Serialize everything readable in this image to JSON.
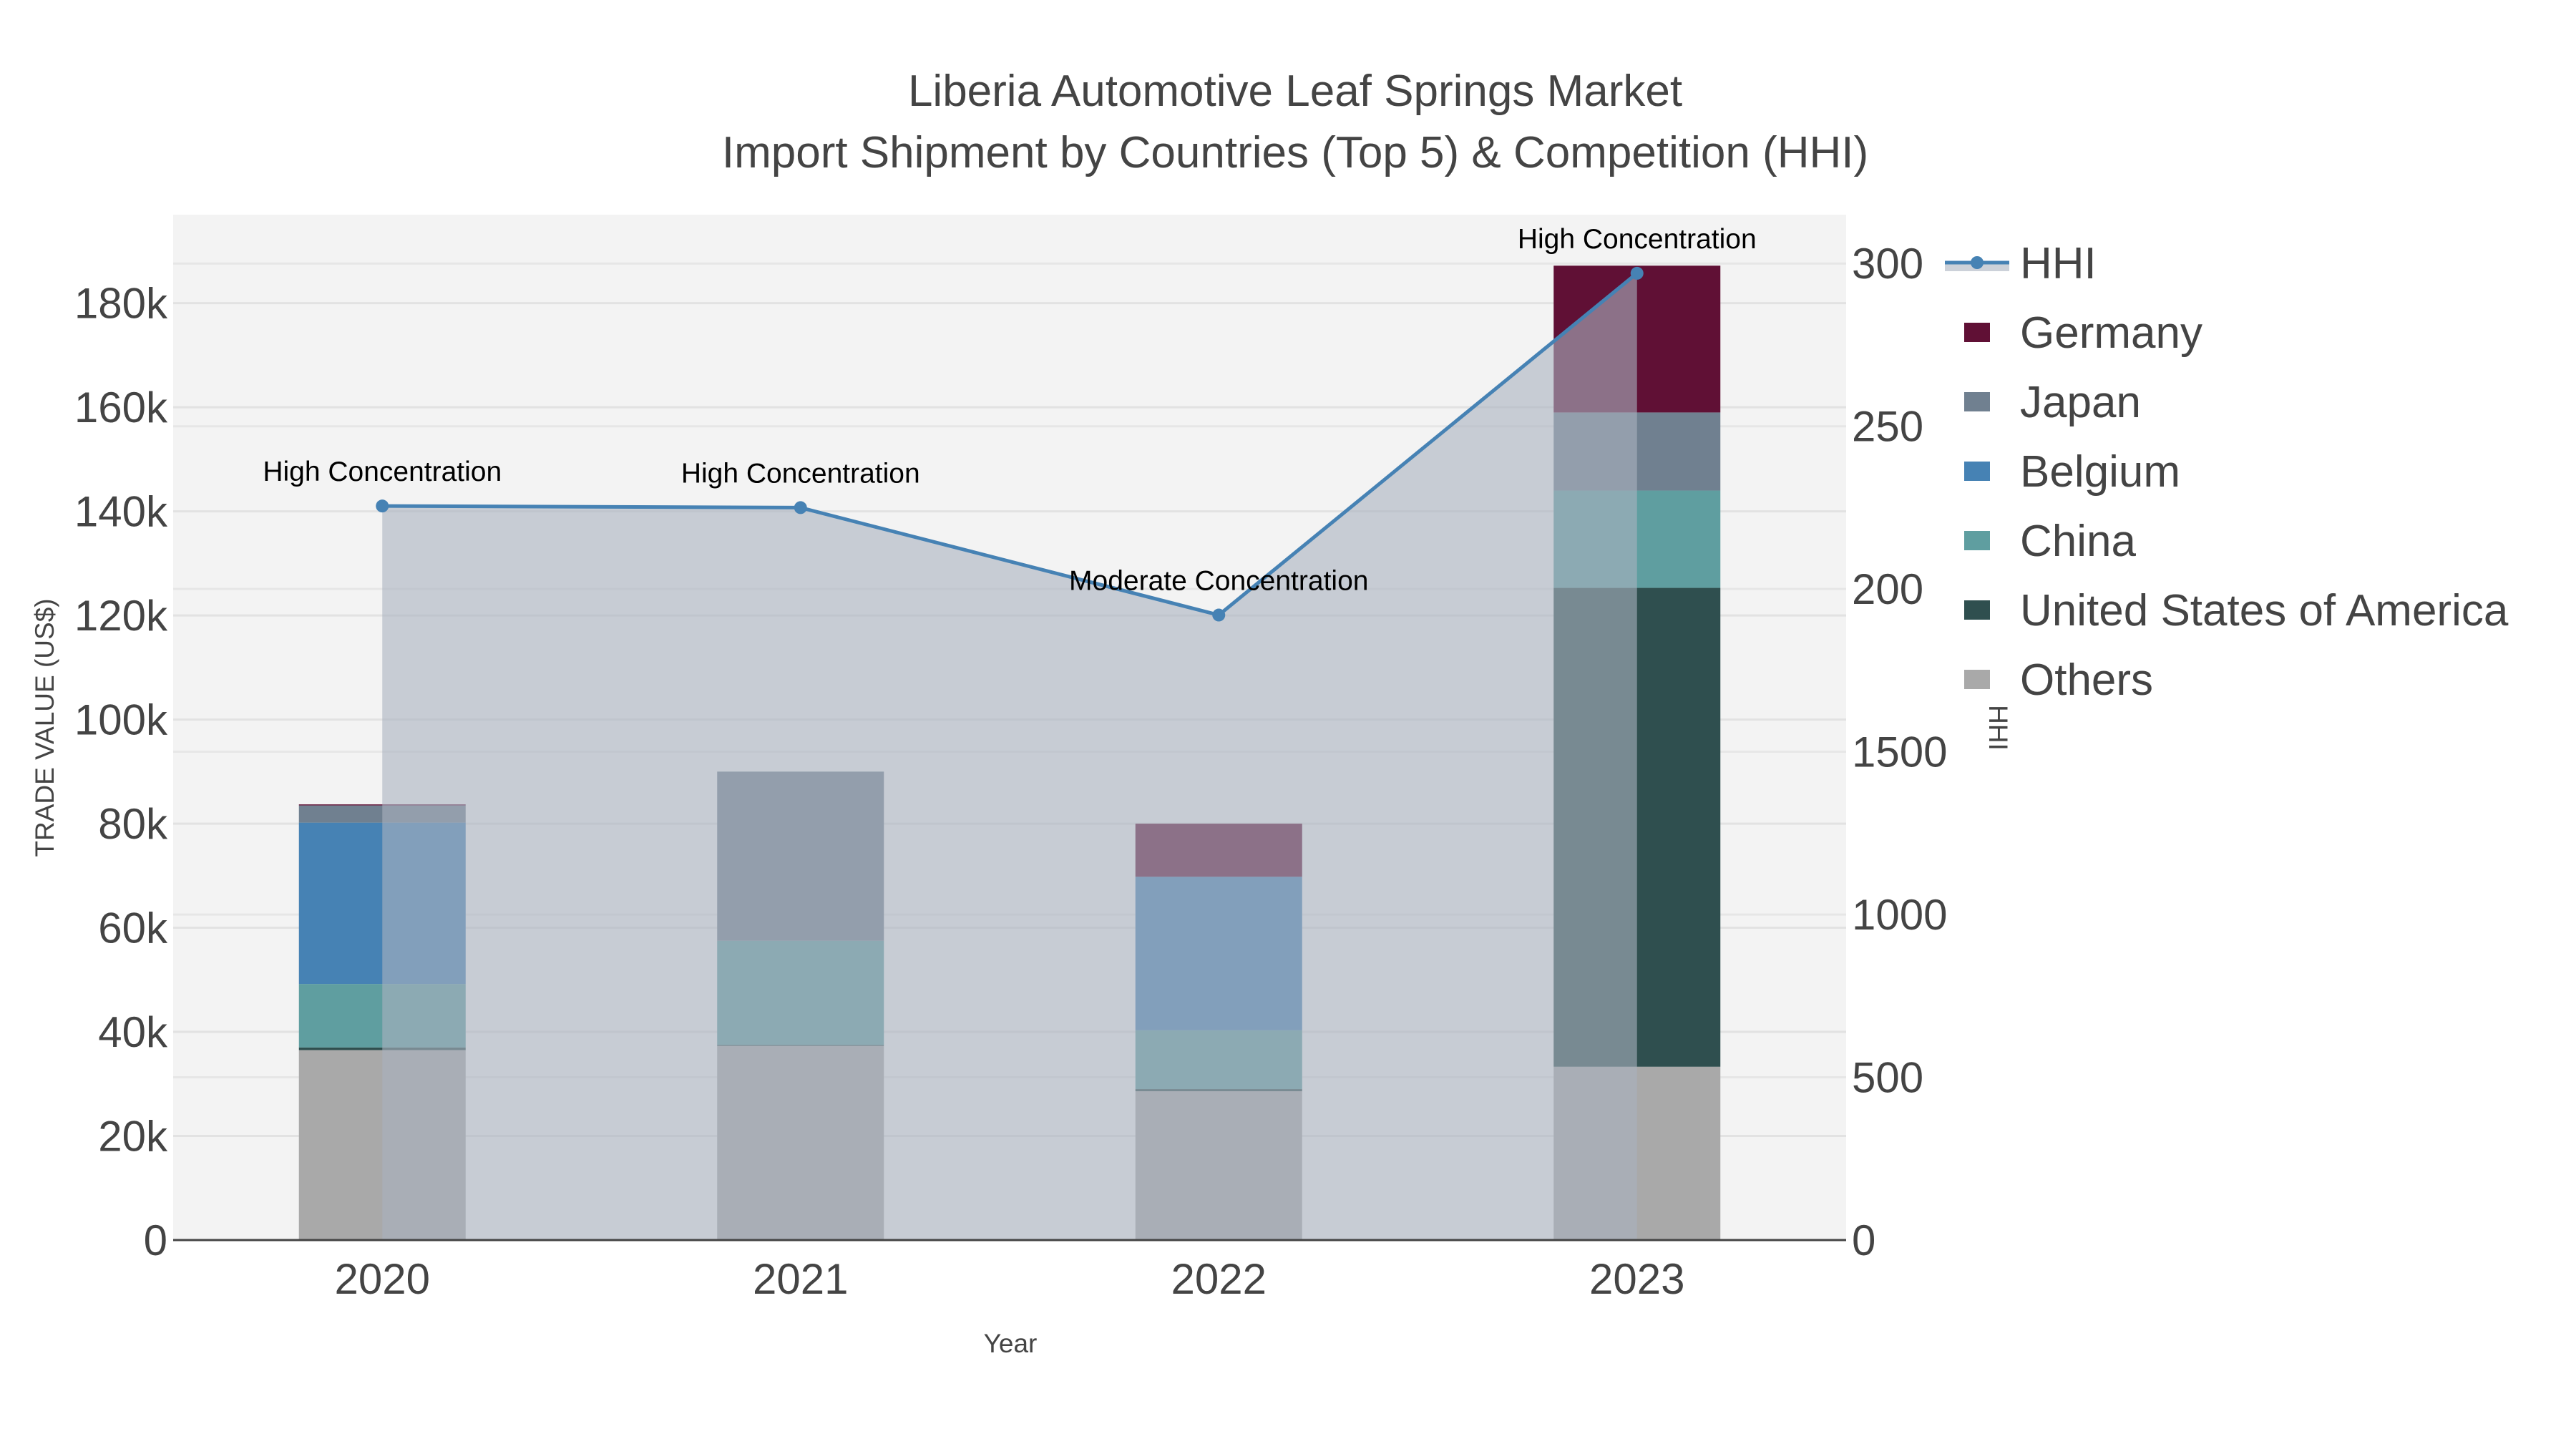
{
  "chart_data": {
    "type": "bar",
    "title": "Liberia Automotive Leaf Springs Market",
    "subtitle": "Import Shipment by Countries (Top 5) & Competition (HHI)",
    "xlabel": "Year",
    "ylabel": "TRADE VALUE (US$)",
    "y2label": "HHI",
    "categories": [
      "2020",
      "2021",
      "2022",
      "2023"
    ],
    "ylim": [
      0,
      197000
    ],
    "yticks": [
      0,
      20000,
      40000,
      60000,
      80000,
      100000,
      120000,
      140000,
      160000,
      180000
    ],
    "ytick_labels": [
      "0",
      "20k",
      "40k",
      "60k",
      "80k",
      "100k",
      "120k",
      "140k",
      "160k",
      "180k"
    ],
    "y2lim": [
      0,
      3150
    ],
    "y2ticks": [
      0,
      500,
      1000,
      1500,
      2000,
      2500,
      3000
    ],
    "y2tick_labels": [
      "0",
      "500",
      "1000",
      "1500",
      "200",
      "250",
      "300"
    ],
    "stacked": true,
    "series": [
      {
        "name": "Others",
        "color": "#a9a9a9",
        "values": [
          36500,
          37300,
          28600,
          33300
        ]
      },
      {
        "name": "United States of America",
        "color": "#2f4f4f",
        "values": [
          500,
          200,
          400,
          92000
        ]
      },
      {
        "name": "China",
        "color": "#5f9ea0",
        "values": [
          12200,
          20000,
          11300,
          18700
        ]
      },
      {
        "name": "Belgium",
        "color": "#4682b4",
        "values": [
          31000,
          0,
          29500,
          0
        ]
      },
      {
        "name": "Japan",
        "color": "#708090",
        "values": [
          3300,
          32500,
          0,
          15000
        ]
      },
      {
        "name": "Germany",
        "color": "#601035",
        "values": [
          200,
          0,
          10200,
          28200
        ]
      }
    ],
    "line": {
      "name": "HHI",
      "color": "#4682b4",
      "fill": "tozeroy",
      "values": [
        2255,
        2250,
        1920,
        2970
      ],
      "annotations": [
        "High Concentration",
        "High Concentration",
        "Moderate Concentration",
        "High Concentration"
      ]
    },
    "legend_order": [
      "HHI",
      "Germany",
      "Japan",
      "Belgium",
      "China",
      "United States of America",
      "Others"
    ],
    "legend_position": "right",
    "grid": true
  }
}
